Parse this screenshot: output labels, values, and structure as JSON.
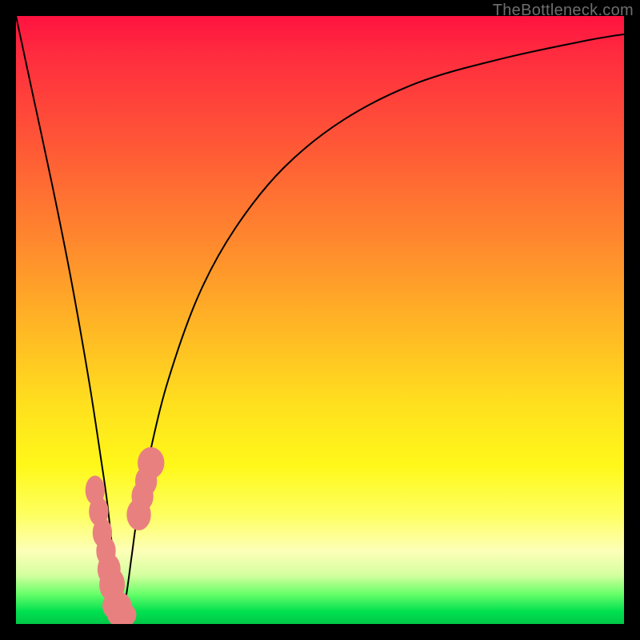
{
  "watermark": "TheBottleneck.com",
  "colors": {
    "curve": "#000000",
    "marker": "#e98080",
    "background_black": "#000000",
    "gradient_top": "#ff1240",
    "gradient_bottom": "#00c848"
  },
  "chart_data": {
    "type": "line",
    "title": "",
    "xlabel": "",
    "ylabel": "",
    "xlim": [
      0,
      100
    ],
    "ylim": [
      0,
      100
    ],
    "grid": false,
    "legend": false,
    "notes": "V-shaped bottleneck curve on a red→green vertical gradient. Y axis is inverted visually (0 at bottom = green = no bottleneck, 100 at top = red = severe). Minimum of curve is around x≈17.",
    "series": [
      {
        "name": "bottleneck-curve",
        "x": [
          0,
          3,
          6,
          9,
          12,
          14,
          15,
          16,
          17,
          18,
          19,
          20,
          22,
          25,
          30,
          36,
          44,
          54,
          66,
          80,
          94,
          100
        ],
        "y": [
          100,
          86,
          72,
          57,
          40,
          27,
          20,
          11,
          2,
          4,
          11,
          18,
          28,
          40,
          54,
          65,
          75,
          83,
          89,
          93,
          96,
          97
        ]
      }
    ],
    "markers_left": {
      "name": "left-cluster",
      "x": [
        13.0,
        13.6,
        14.2,
        14.8,
        15.3,
        15.8,
        16.6,
        17.4
      ],
      "y": [
        22.0,
        18.5,
        15.0,
        12.0,
        9.0,
        6.5,
        3.0,
        1.5
      ],
      "rx": [
        1.6,
        1.6,
        1.6,
        1.6,
        1.9,
        2.1,
        2.4,
        2.4
      ],
      "ry": [
        2.4,
        2.4,
        2.4,
        2.4,
        2.6,
        2.8,
        2.4,
        2.1
      ]
    },
    "markers_right": {
      "name": "right-cluster",
      "x": [
        20.2,
        20.8,
        21.4,
        22.2
      ],
      "y": [
        18.0,
        21.0,
        23.5,
        26.5
      ],
      "rx": [
        2.0,
        1.8,
        1.8,
        2.2
      ],
      "ry": [
        2.6,
        2.4,
        2.4,
        2.6
      ]
    }
  }
}
